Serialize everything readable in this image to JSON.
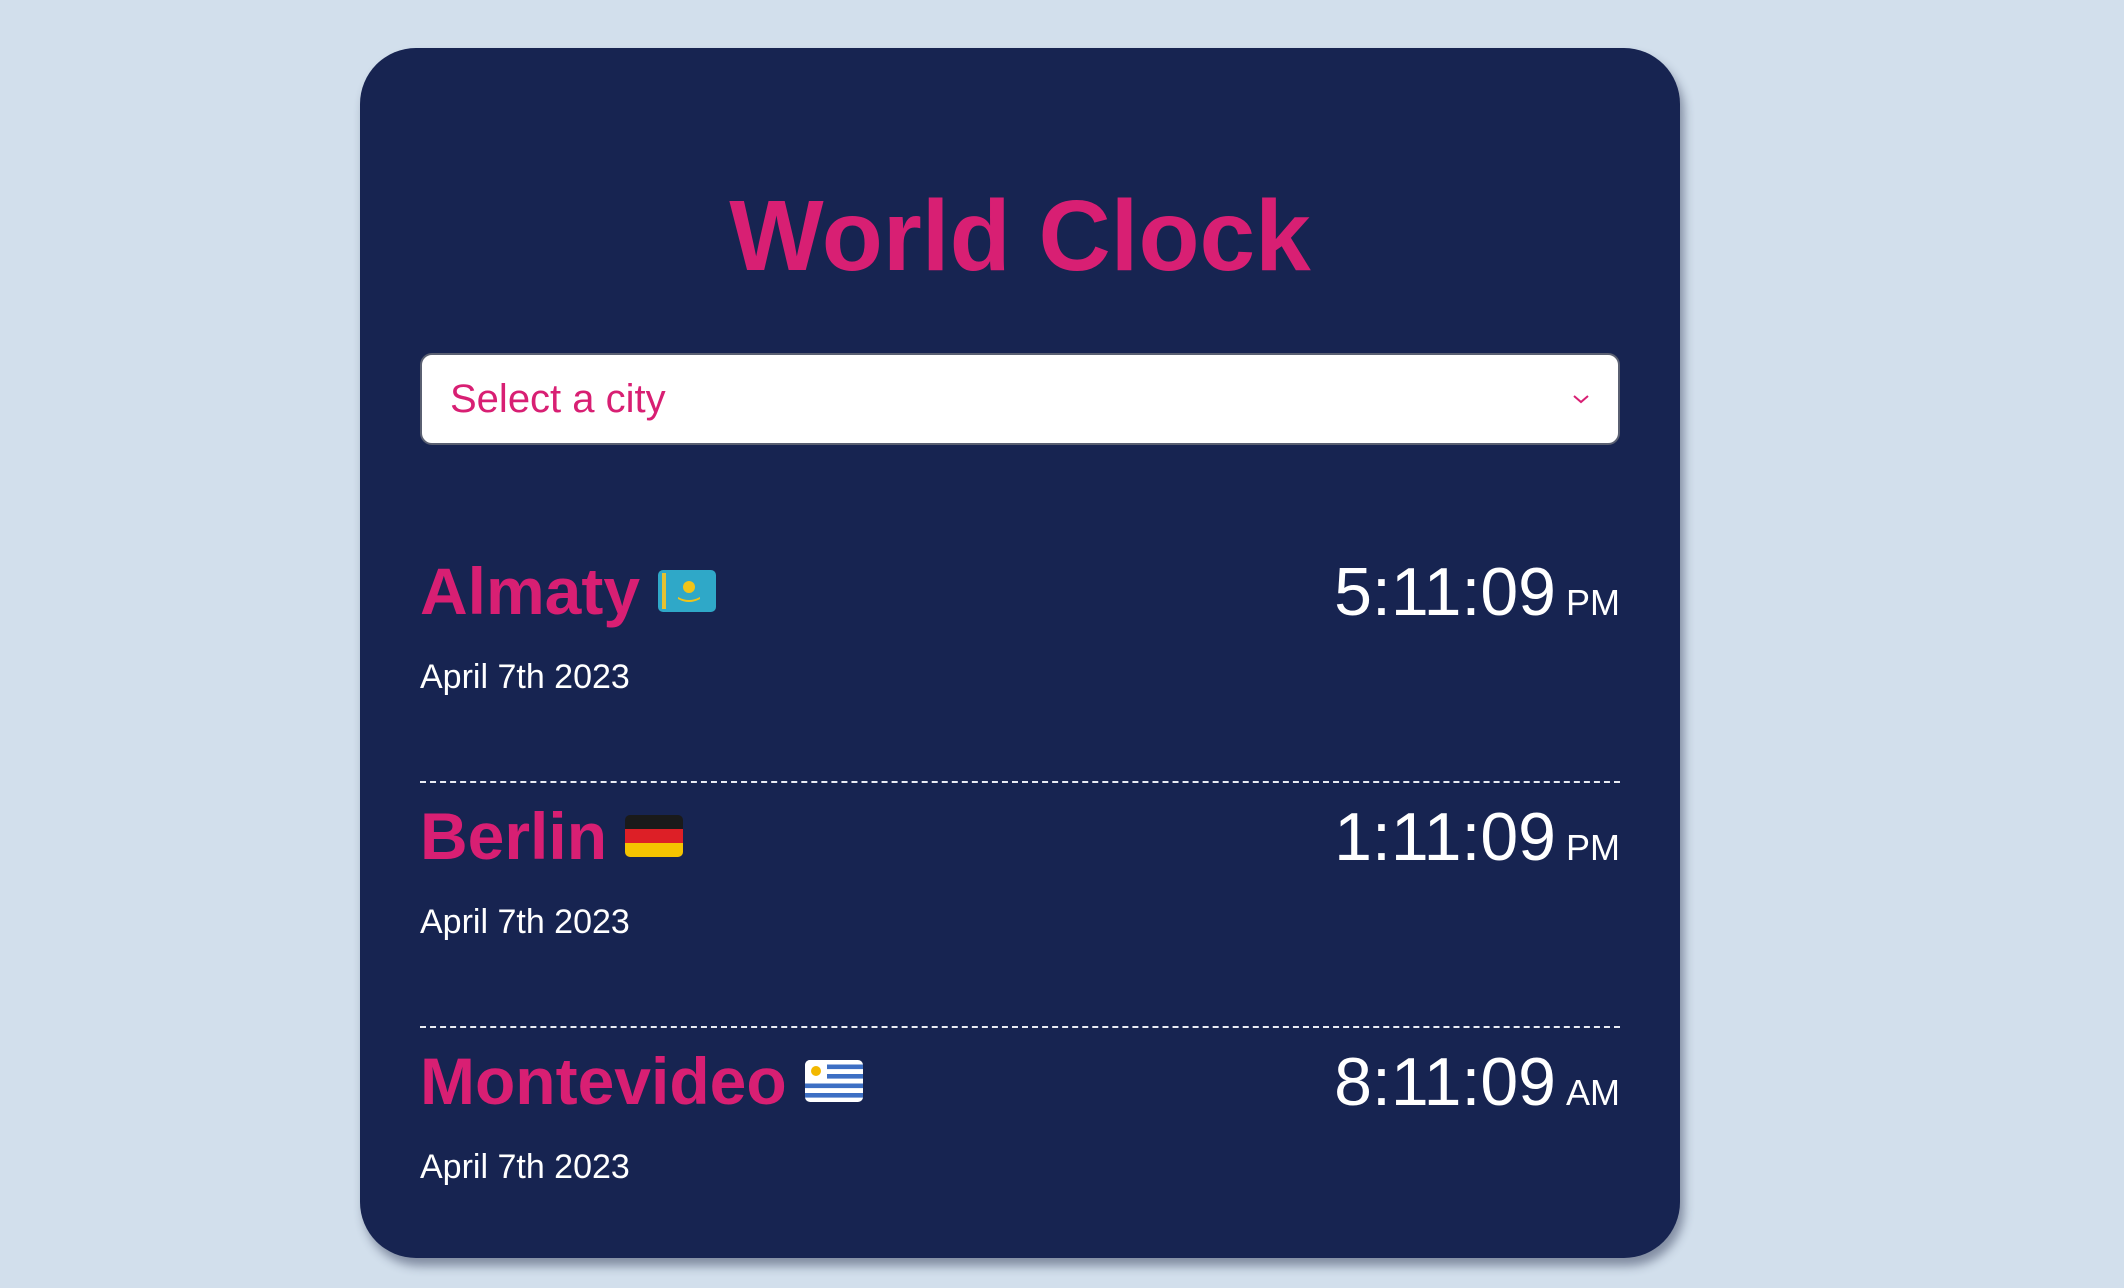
{
  "app": {
    "title": "World Clock"
  },
  "select": {
    "value": "Select a city",
    "icon": "chevron-down-icon"
  },
  "cities": [
    {
      "name": "Almaty",
      "flag_icon": "kazakhstan-flag-icon",
      "time": "5:11:09",
      "period": "PM",
      "date": "April 7th 2023"
    },
    {
      "name": "Berlin",
      "flag_icon": "germany-flag-icon",
      "time": "1:11:09",
      "period": "PM",
      "date": "April 7th 2023"
    },
    {
      "name": "Montevideo",
      "flag_icon": "uruguay-flag-icon",
      "time": "8:11:09",
      "period": "AM",
      "date": "April 7th 2023"
    }
  ],
  "colors": {
    "background": "#d2dfec",
    "card": "#172451",
    "accent": "#d81f73",
    "text": "#ffffff"
  }
}
